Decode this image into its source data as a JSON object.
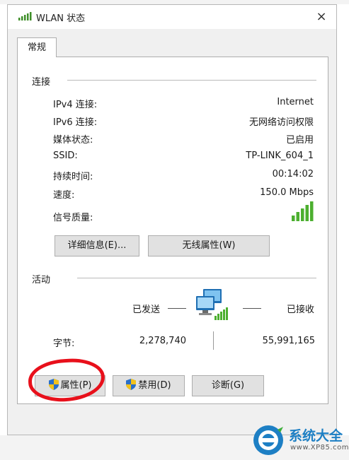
{
  "window": {
    "title": "WLAN 状态",
    "close_glyph": "×"
  },
  "tab": {
    "label": "常规"
  },
  "connection": {
    "section_title": "连接",
    "rows": [
      {
        "label": "IPv4 连接:",
        "value": "Internet"
      },
      {
        "label": "IPv6 连接:",
        "value": "无网络访问权限"
      },
      {
        "label": "媒体状态:",
        "value": "已启用"
      },
      {
        "label": "SSID:",
        "value": "TP-LINK_604_1"
      },
      {
        "label": "持续时间:",
        "value": "00:14:02"
      },
      {
        "label": "速度:",
        "value": "150.0 Mbps"
      }
    ],
    "signal_label": "信号质量:",
    "signal_bars": 5,
    "signal_color": "#4caf2f",
    "details_button": "详细信息(E)...",
    "wireless_props_button": "无线属性(W)"
  },
  "activity": {
    "section_title": "活动",
    "sent_label": "已发送",
    "received_label": "已接收",
    "bytes_label": "字节:",
    "bytes_sent": "2,278,740",
    "bytes_received": "55,991,165"
  },
  "buttons": {
    "properties": "属性(P)",
    "disable": "禁用(D)",
    "diagnose": "诊断(G)"
  },
  "watermark": {
    "text": "系统大全",
    "url": "www.XP85.com",
    "accent_color": "#1d7fc4"
  }
}
